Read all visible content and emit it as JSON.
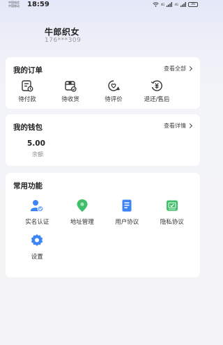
{
  "status_bar": {
    "carrier_1": "中国电信",
    "carrier_2": "中国移动",
    "time": "18:59",
    "signal_1": "4G",
    "signal_2": "4G",
    "battery": "30"
  },
  "profile": {
    "username": "牛郎织女",
    "phone": "176***309"
  },
  "orders": {
    "title": "我的订单",
    "view_all": "查看全部",
    "items": [
      {
        "label": "待付款",
        "icon": "pending-payment-icon"
      },
      {
        "label": "待收货",
        "icon": "pending-receipt-icon"
      },
      {
        "label": "待评价",
        "icon": "pending-review-icon"
      },
      {
        "label": "退还/售后",
        "icon": "refund-icon"
      }
    ]
  },
  "wallet": {
    "title": "我的钱包",
    "view_details": "查看详情",
    "balance": "5.00",
    "balance_label": "余额"
  },
  "functions": {
    "title": "常用功能",
    "items": [
      {
        "label": "实名认证",
        "icon": "user-verify-icon",
        "color": "#3d84f5"
      },
      {
        "label": "地址管理",
        "icon": "location-icon",
        "color": "#3fbf6a"
      },
      {
        "label": "用户协议",
        "icon": "document-icon",
        "color": "#3d84f5"
      },
      {
        "label": "隐私协议",
        "icon": "privacy-icon",
        "color": "#3fbf6a"
      },
      {
        "label": "设置",
        "icon": "gear-icon",
        "color": "#3d84f5"
      }
    ]
  }
}
